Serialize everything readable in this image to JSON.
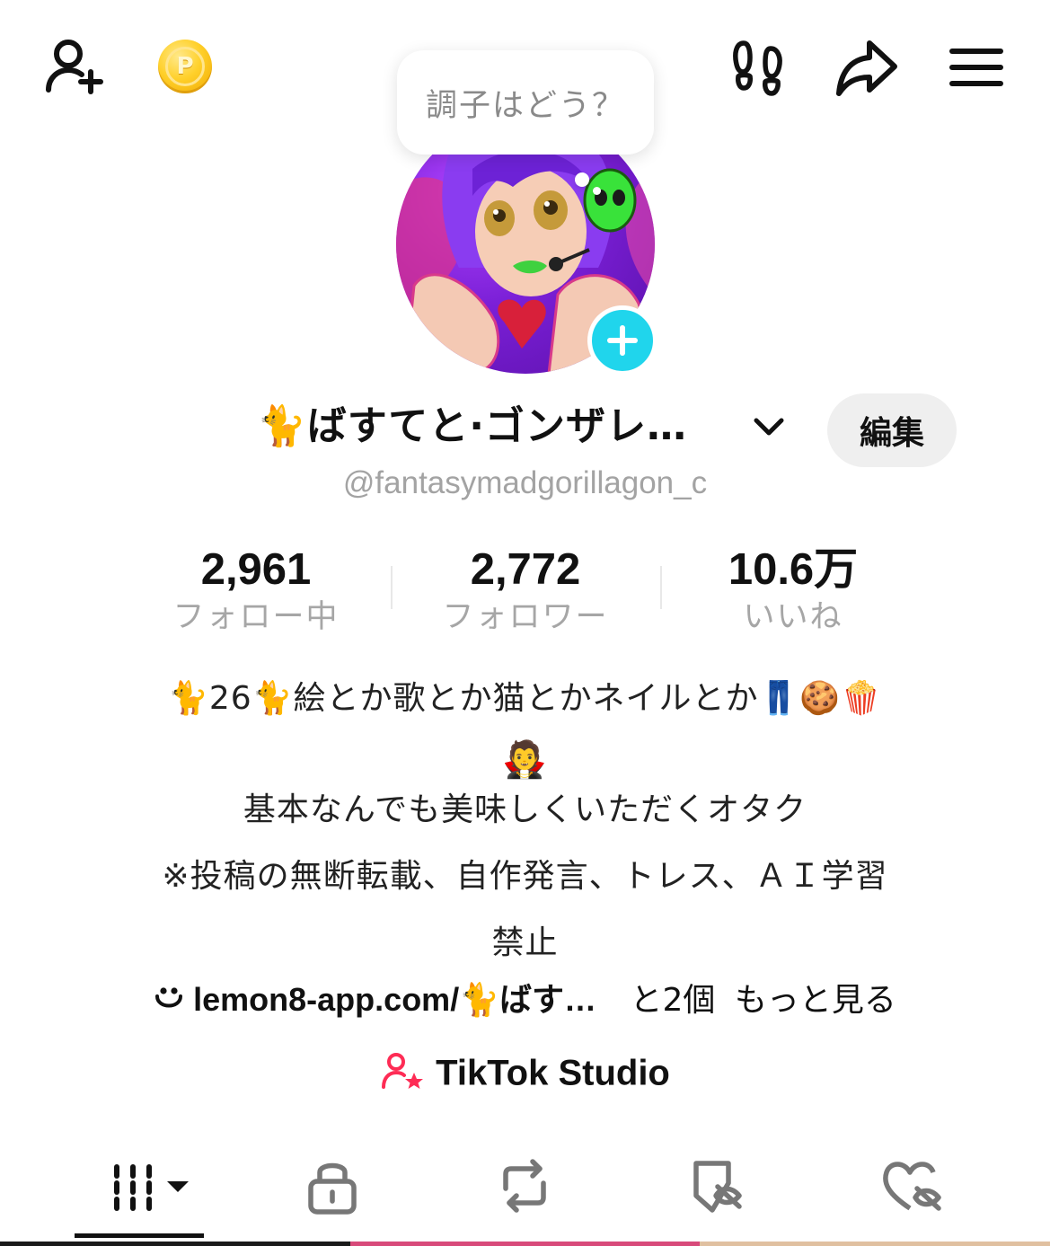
{
  "top_bar": {
    "icons": [
      "add-friend-icon",
      "coin-icon",
      "footprints-icon",
      "share-icon",
      "menu-icon"
    ],
    "coin_letter": "P"
  },
  "bubble": {
    "text": "調子はどう？"
  },
  "profile": {
    "name": "🐈ばすてと·ゴンザレ…",
    "handle": "@fantasymadgorillagon_c",
    "edit_label": "編集"
  },
  "stats": [
    {
      "value": "2,961",
      "label": "フォロー中"
    },
    {
      "value": "2,772",
      "label": "フォロワー"
    },
    {
      "value": "10.6万",
      "label": "いいね"
    }
  ],
  "bio": {
    "line1": "🐈26🐈絵とか歌とか猫とかネイルとか👖🍪🍿",
    "line2": "🧛",
    "line3": "基本なんでも美味しくいただくオタク",
    "line4": "※投稿の無断転載、自作発言、トレス、ＡＩ学習",
    "line5": "禁止"
  },
  "links": {
    "url": "lemon8-app.com/🐈ばす…",
    "extra": "と2個",
    "more": "もっと見る"
  },
  "studio": {
    "label": "TikTok Studio"
  },
  "tabs": [
    "grid-icon",
    "lock-icon",
    "repost-icon",
    "saved-icon",
    "liked-icon"
  ],
  "colors": {
    "accent_cyan": "#20d5ec",
    "studio_pink": "#fe2c55",
    "coin_gold": "#ffd02a"
  }
}
